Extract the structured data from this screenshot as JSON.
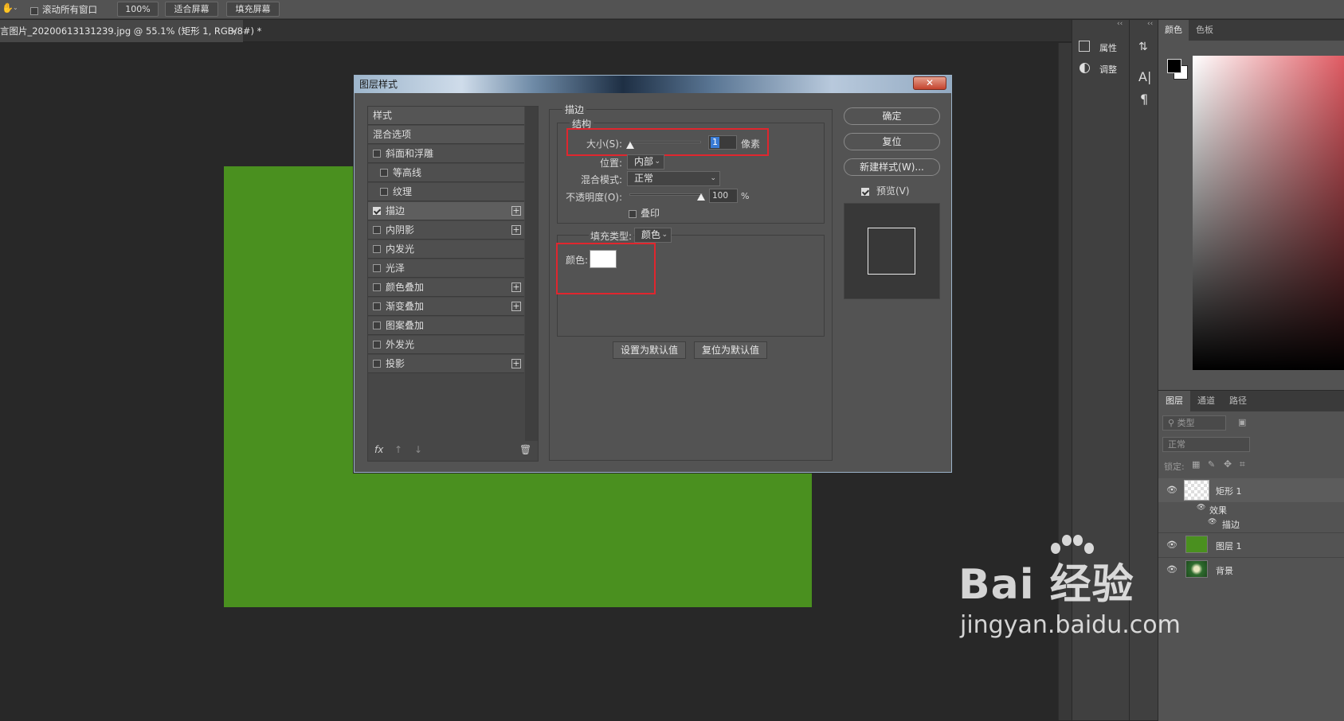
{
  "options_bar": {
    "scroll_all_label": "滚动所有窗口",
    "zoom_label": "100%",
    "fit_screen_label": "适合屏幕",
    "fill_screen_label": "填充屏幕"
  },
  "document_tab": {
    "title": "言图片_20200613131239.jpg @ 55.1% (矩形 1, RGB/8#) *",
    "close": "×"
  },
  "canvas": {
    "rect_color": "#4a901f"
  },
  "dock": {
    "properties_label": "属性",
    "adjustments_label": "调整",
    "collapse": "‹‹"
  },
  "color_panel": {
    "tabs": [
      "颜色",
      "色板"
    ]
  },
  "layers_panel": {
    "tabs": [
      "图层",
      "通道",
      "路径"
    ],
    "filter_placeholder": "类型",
    "blend_mode": "正常",
    "lock_label": "锁定:",
    "layers": [
      {
        "name": "矩形 1"
      },
      {
        "name": "效果"
      },
      {
        "name": "描边"
      },
      {
        "name": "图层 1"
      },
      {
        "name": "背景"
      }
    ]
  },
  "dialog": {
    "title": "图层样式",
    "close": "✕",
    "styles_header": "样式",
    "blend_options": "混合选项",
    "style_items": [
      {
        "label": "斜面和浮雕",
        "checked": false,
        "indent": false,
        "plus": false
      },
      {
        "label": "等高线",
        "checked": false,
        "indent": true,
        "plus": false
      },
      {
        "label": "纹理",
        "checked": false,
        "indent": true,
        "plus": false
      },
      {
        "label": "描边",
        "checked": true,
        "indent": false,
        "plus": true,
        "selected": true
      },
      {
        "label": "内阴影",
        "checked": false,
        "indent": false,
        "plus": true
      },
      {
        "label": "内发光",
        "checked": false,
        "indent": false,
        "plus": false
      },
      {
        "label": "光泽",
        "checked": false,
        "indent": false,
        "plus": false
      },
      {
        "label": "颜色叠加",
        "checked": false,
        "indent": false,
        "plus": true
      },
      {
        "label": "渐变叠加",
        "checked": false,
        "indent": false,
        "plus": true
      },
      {
        "label": "图案叠加",
        "checked": false,
        "indent": false,
        "plus": false
      },
      {
        "label": "外发光",
        "checked": false,
        "indent": false,
        "plus": false
      },
      {
        "label": "投影",
        "checked": false,
        "indent": false,
        "plus": true
      }
    ],
    "bottom_fx": "fx",
    "stroke": {
      "group_title": "描边",
      "structure_title": "结构",
      "size_label": "大小(S):",
      "size_value": "1",
      "size_unit": "像素",
      "position_label": "位置:",
      "position_value": "内部",
      "blend_label": "混合模式:",
      "blend_value": "正常",
      "opacity_label": "不透明度(O):",
      "opacity_value": "100",
      "opacity_unit": "%",
      "overprint_label": "叠印",
      "fill_type_label": "填充类型:",
      "fill_type_value": "颜色",
      "color_label": "颜色:",
      "color_value": "#ffffff",
      "set_default": "设置为默认值",
      "reset_default": "复位为默认值"
    },
    "buttons": {
      "ok": "确定",
      "reset": "复位",
      "new_style": "新建样式(W)...",
      "preview": "预览(V)"
    }
  },
  "watermark": {
    "brand": "Bai 经验",
    "url": "jingyan.baidu.com"
  }
}
